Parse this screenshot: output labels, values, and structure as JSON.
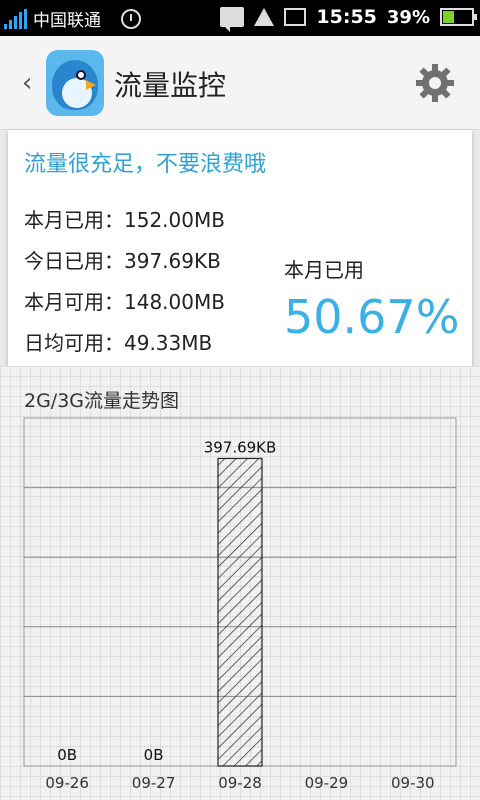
{
  "status_bar": {
    "carrier": "中国联通",
    "time": "15:55",
    "battery": "39%",
    "icons": [
      "signal-icon",
      "alarm-clock-icon",
      "message-icon",
      "warning-icon",
      "image-icon",
      "battery-charging-icon"
    ]
  },
  "header": {
    "title": "流量监控",
    "back_icon": "back-chevron-icon",
    "settings_icon": "gear-icon"
  },
  "summary": {
    "tip": "流量很充足，不要浪费哦",
    "month_used": "本月已用：152.00MB",
    "today_used": "今日已用：397.69KB",
    "month_available": "本月可用：148.00MB",
    "daily_available": "日均可用：49.33MB",
    "used_label": "本月已用",
    "used_percent": "50.67%"
  },
  "chart_title": "2G/3G流量走势图",
  "chart_data": {
    "type": "bar",
    "title": "2G/3G流量走势图",
    "categories": [
      "09-26",
      "09-27",
      "09-28",
      "09-29",
      "09-30"
    ],
    "values_kb": [
      0,
      0,
      397.69,
      null,
      null
    ],
    "data_labels": [
      "0B",
      "0B",
      "397.69KB",
      "",
      ""
    ],
    "ylim": [
      0,
      450
    ],
    "grid": true
  },
  "colors": {
    "accent": "#39b0e6",
    "tip": "#2fa3d6",
    "status_bar": "#000000"
  }
}
